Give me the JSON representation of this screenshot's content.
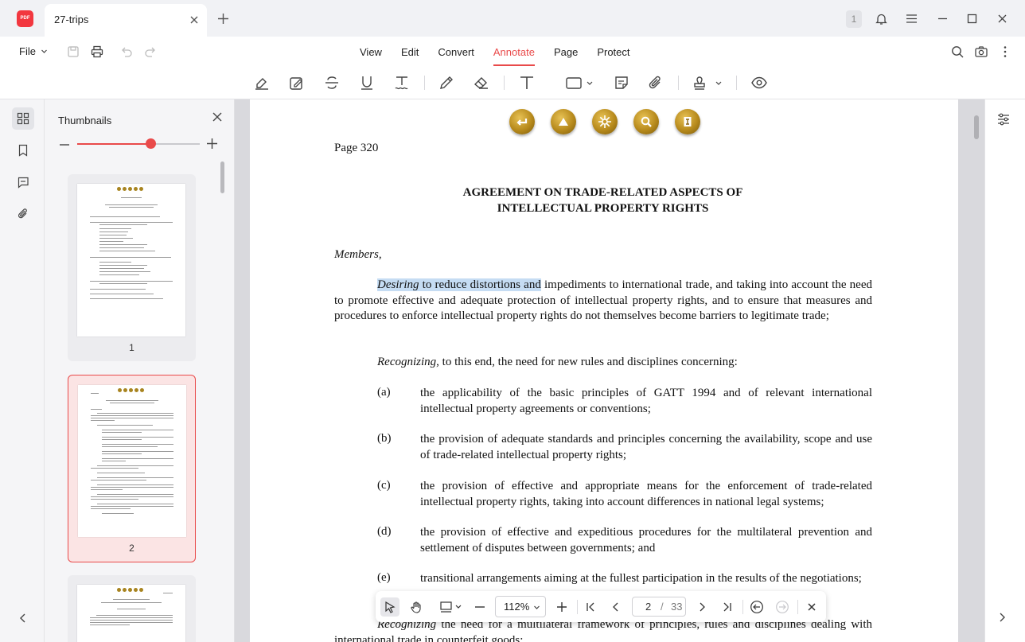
{
  "app": {
    "logo_text": "PDF"
  },
  "tab": {
    "title": "27-trips"
  },
  "window": {
    "badge": "1"
  },
  "menu": {
    "file": "File",
    "items": [
      "View",
      "Edit",
      "Convert",
      "Annotate",
      "Page",
      "Protect"
    ],
    "active": "Annotate"
  },
  "annotate_tools": [
    "highlight-icon",
    "area-highlight-icon",
    "strikethrough-icon",
    "underline-icon",
    "squiggly-icon",
    "pencil-icon",
    "eraser-icon",
    "text-box-icon",
    "shape-icon",
    "sticky-note-icon",
    "attachment-icon",
    "stamp-icon",
    "eye-icon"
  ],
  "thumbnails": {
    "title": "Thumbnails",
    "zoom_level": 0.6,
    "pages": [
      {
        "number": "1",
        "selected": false
      },
      {
        "number": "2",
        "selected": true
      }
    ]
  },
  "document": {
    "page_label": "Page 320",
    "title_line1": "AGREEMENT ON TRADE-RELATED ASPECTS OF",
    "title_line2": "INTELLECTUAL PROPERTY RIGHTS",
    "members": "Members,",
    "para1": {
      "italic_word": "Desiring",
      "highlighted_rest": " to reduce distortions and",
      "rest": " impediments to international trade, and taking into account the need to promote effective and adequate protection of intellectual property rights, and to ensure that measures and procedures to enforce intellectual property rights do not themselves become barriers to legitimate trade;"
    },
    "para2": {
      "italic_word": "Recognizing",
      "rest": ", to this end, the need for new rules and disciplines concerning:"
    },
    "items": [
      {
        "letter": "(a)",
        "text": "the applicability of the basic principles of GATT 1994 and of relevant international intellectual property agreements or conventions;"
      },
      {
        "letter": "(b)",
        "text": "the provision of adequate standards and principles concerning the availability, scope and use of trade-related intellectual property rights;"
      },
      {
        "letter": "(c)",
        "text": "the provision of effective and appropriate means for the enforcement of trade-related intellectual property rights, taking into account differences in national legal systems;"
      },
      {
        "letter": "(d)",
        "text": "the provision of effective and expeditious procedures for the multilateral prevention and settlement of disputes between governments;  and"
      },
      {
        "letter": "(e)",
        "text": "transitional arrangements aiming at the fullest participation in the results of the negotiations;"
      }
    ],
    "para3": {
      "italic_word": "Recognizing",
      "rest": " the need for a multilateral framework of principles, rules and disciplines dealing with international trade in counterfeit goods;"
    }
  },
  "bottom_bar": {
    "zoom": "112%",
    "current_page": "2",
    "separator": "/",
    "total_pages": "33"
  }
}
